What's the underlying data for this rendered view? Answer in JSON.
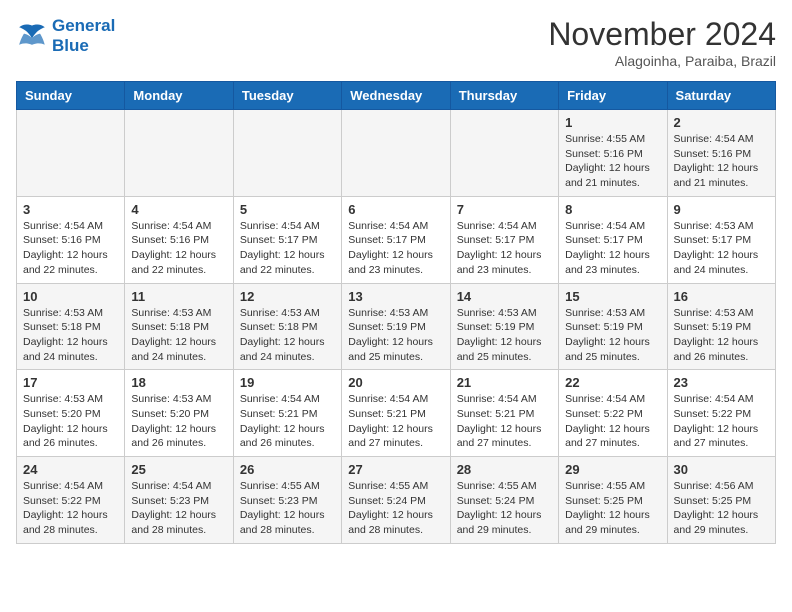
{
  "header": {
    "logo_line1": "General",
    "logo_line2": "Blue",
    "month": "November 2024",
    "location": "Alagoinha, Paraiba, Brazil"
  },
  "weekdays": [
    "Sunday",
    "Monday",
    "Tuesday",
    "Wednesday",
    "Thursday",
    "Friday",
    "Saturday"
  ],
  "weeks": [
    [
      {
        "day": "",
        "info": ""
      },
      {
        "day": "",
        "info": ""
      },
      {
        "day": "",
        "info": ""
      },
      {
        "day": "",
        "info": ""
      },
      {
        "day": "",
        "info": ""
      },
      {
        "day": "1",
        "info": "Sunrise: 4:55 AM\nSunset: 5:16 PM\nDaylight: 12 hours and 21 minutes."
      },
      {
        "day": "2",
        "info": "Sunrise: 4:54 AM\nSunset: 5:16 PM\nDaylight: 12 hours and 21 minutes."
      }
    ],
    [
      {
        "day": "3",
        "info": "Sunrise: 4:54 AM\nSunset: 5:16 PM\nDaylight: 12 hours and 22 minutes."
      },
      {
        "day": "4",
        "info": "Sunrise: 4:54 AM\nSunset: 5:16 PM\nDaylight: 12 hours and 22 minutes."
      },
      {
        "day": "5",
        "info": "Sunrise: 4:54 AM\nSunset: 5:17 PM\nDaylight: 12 hours and 22 minutes."
      },
      {
        "day": "6",
        "info": "Sunrise: 4:54 AM\nSunset: 5:17 PM\nDaylight: 12 hours and 23 minutes."
      },
      {
        "day": "7",
        "info": "Sunrise: 4:54 AM\nSunset: 5:17 PM\nDaylight: 12 hours and 23 minutes."
      },
      {
        "day": "8",
        "info": "Sunrise: 4:54 AM\nSunset: 5:17 PM\nDaylight: 12 hours and 23 minutes."
      },
      {
        "day": "9",
        "info": "Sunrise: 4:53 AM\nSunset: 5:17 PM\nDaylight: 12 hours and 24 minutes."
      }
    ],
    [
      {
        "day": "10",
        "info": "Sunrise: 4:53 AM\nSunset: 5:18 PM\nDaylight: 12 hours and 24 minutes."
      },
      {
        "day": "11",
        "info": "Sunrise: 4:53 AM\nSunset: 5:18 PM\nDaylight: 12 hours and 24 minutes."
      },
      {
        "day": "12",
        "info": "Sunrise: 4:53 AM\nSunset: 5:18 PM\nDaylight: 12 hours and 24 minutes."
      },
      {
        "day": "13",
        "info": "Sunrise: 4:53 AM\nSunset: 5:19 PM\nDaylight: 12 hours and 25 minutes."
      },
      {
        "day": "14",
        "info": "Sunrise: 4:53 AM\nSunset: 5:19 PM\nDaylight: 12 hours and 25 minutes."
      },
      {
        "day": "15",
        "info": "Sunrise: 4:53 AM\nSunset: 5:19 PM\nDaylight: 12 hours and 25 minutes."
      },
      {
        "day": "16",
        "info": "Sunrise: 4:53 AM\nSunset: 5:19 PM\nDaylight: 12 hours and 26 minutes."
      }
    ],
    [
      {
        "day": "17",
        "info": "Sunrise: 4:53 AM\nSunset: 5:20 PM\nDaylight: 12 hours and 26 minutes."
      },
      {
        "day": "18",
        "info": "Sunrise: 4:53 AM\nSunset: 5:20 PM\nDaylight: 12 hours and 26 minutes."
      },
      {
        "day": "19",
        "info": "Sunrise: 4:54 AM\nSunset: 5:21 PM\nDaylight: 12 hours and 26 minutes."
      },
      {
        "day": "20",
        "info": "Sunrise: 4:54 AM\nSunset: 5:21 PM\nDaylight: 12 hours and 27 minutes."
      },
      {
        "day": "21",
        "info": "Sunrise: 4:54 AM\nSunset: 5:21 PM\nDaylight: 12 hours and 27 minutes."
      },
      {
        "day": "22",
        "info": "Sunrise: 4:54 AM\nSunset: 5:22 PM\nDaylight: 12 hours and 27 minutes."
      },
      {
        "day": "23",
        "info": "Sunrise: 4:54 AM\nSunset: 5:22 PM\nDaylight: 12 hours and 27 minutes."
      }
    ],
    [
      {
        "day": "24",
        "info": "Sunrise: 4:54 AM\nSunset: 5:22 PM\nDaylight: 12 hours and 28 minutes."
      },
      {
        "day": "25",
        "info": "Sunrise: 4:54 AM\nSunset: 5:23 PM\nDaylight: 12 hours and 28 minutes."
      },
      {
        "day": "26",
        "info": "Sunrise: 4:55 AM\nSunset: 5:23 PM\nDaylight: 12 hours and 28 minutes."
      },
      {
        "day": "27",
        "info": "Sunrise: 4:55 AM\nSunset: 5:24 PM\nDaylight: 12 hours and 28 minutes."
      },
      {
        "day": "28",
        "info": "Sunrise: 4:55 AM\nSunset: 5:24 PM\nDaylight: 12 hours and 29 minutes."
      },
      {
        "day": "29",
        "info": "Sunrise: 4:55 AM\nSunset: 5:25 PM\nDaylight: 12 hours and 29 minutes."
      },
      {
        "day": "30",
        "info": "Sunrise: 4:56 AM\nSunset: 5:25 PM\nDaylight: 12 hours and 29 minutes."
      }
    ]
  ]
}
